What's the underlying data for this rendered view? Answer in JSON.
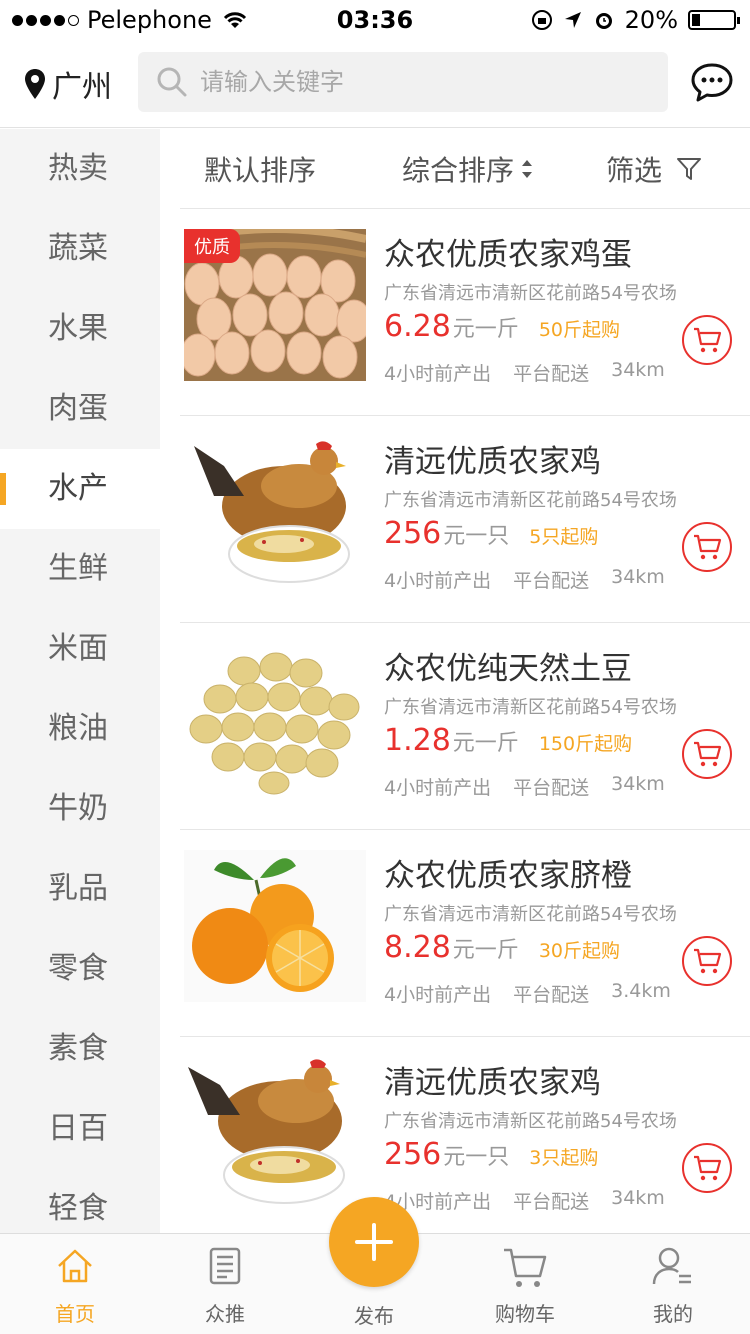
{
  "status_bar": {
    "carrier": "Pelephone",
    "time": "03:36",
    "battery": "20%"
  },
  "header": {
    "location": "广州",
    "search_placeholder": "请输入关键字"
  },
  "categories": [
    {
      "label": "热卖"
    },
    {
      "label": "蔬菜"
    },
    {
      "label": "水果"
    },
    {
      "label": "肉蛋"
    },
    {
      "label": "水产"
    },
    {
      "label": "生鲜"
    },
    {
      "label": "米面"
    },
    {
      "label": "粮油"
    },
    {
      "label": "牛奶"
    },
    {
      "label": "乳品"
    },
    {
      "label": "零食"
    },
    {
      "label": "素食"
    },
    {
      "label": "日百"
    },
    {
      "label": "轻食"
    }
  ],
  "active_category": "水产",
  "sort": {
    "default": "默认排序",
    "composite": "综合排序",
    "filter": "筛选"
  },
  "products": [
    {
      "badge": "优质",
      "name": "众农优质农家鸡蛋",
      "address": "广东省清远市清新区花前路54号农场",
      "price": "6.28",
      "unit": "元一斤",
      "min_buy": "50斤起购",
      "produced": "4小时前产出",
      "delivery": "平台配送",
      "distance": "34km",
      "image": "eggs"
    },
    {
      "badge": "",
      "name": "清远优质农家鸡",
      "address": "广东省清远市清新区花前路54号农场",
      "price": "256",
      "unit": "元一只",
      "min_buy": "5只起购",
      "produced": "4小时前产出",
      "delivery": "平台配送",
      "distance": "34km",
      "image": "chicken"
    },
    {
      "badge": "",
      "name": "众农优纯天然土豆",
      "address": "广东省清远市清新区花前路54号农场",
      "price": "1.28",
      "unit": "元一斤",
      "min_buy": "150斤起购",
      "produced": "4小时前产出",
      "delivery": "平台配送",
      "distance": "34km",
      "image": "potato"
    },
    {
      "badge": "",
      "name": "众农优质农家脐橙",
      "address": "广东省清远市清新区花前路54号农场",
      "price": "8.28",
      "unit": "元一斤",
      "min_buy": "30斤起购",
      "produced": "4小时前产出",
      "delivery": "平台配送",
      "distance": "3.4km",
      "image": "orange"
    },
    {
      "badge": "",
      "name": "清远优质农家鸡",
      "address": "广东省清远市清新区花前路54号农场",
      "price": "256",
      "unit": "元一只",
      "min_buy": "3只起购",
      "produced": "4小时前产出",
      "delivery": "平台配送",
      "distance": "34km",
      "image": "chicken"
    }
  ],
  "tabs": {
    "home": "首页",
    "recommend": "众推",
    "publish": "发布",
    "cart": "购物车",
    "mine": "我的"
  },
  "colors": {
    "accent": "#f5a623",
    "price": "#e8312d"
  }
}
